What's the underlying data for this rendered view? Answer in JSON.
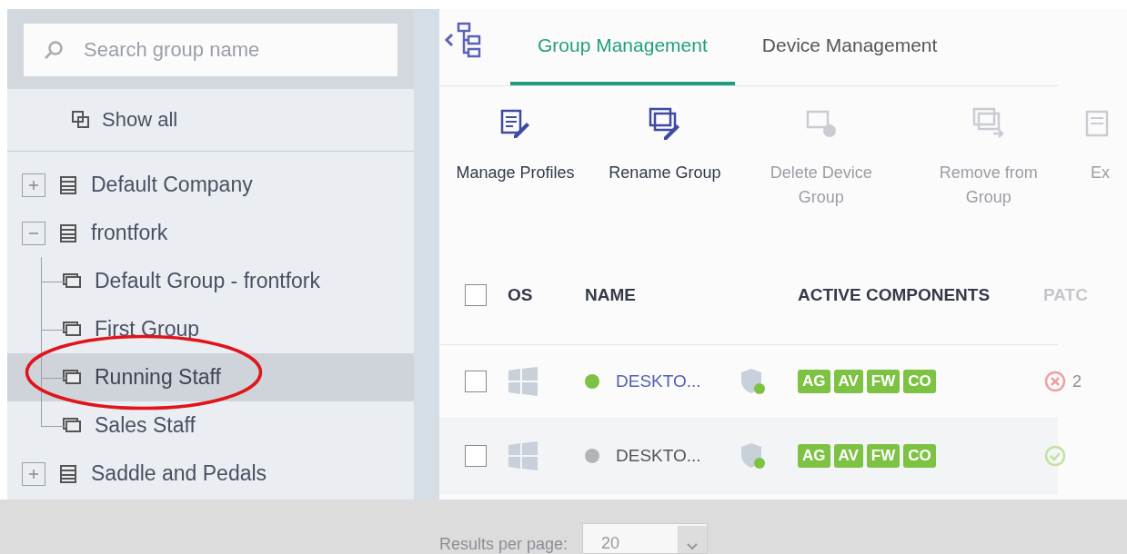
{
  "sidebar": {
    "search": {
      "placeholder": "Search group name"
    },
    "show_all": "Show all",
    "tree": [
      {
        "label": "Default Company",
        "expanded": false,
        "selected": false
      },
      {
        "label": "frontfork",
        "expanded": true,
        "selected": false,
        "children": [
          {
            "label": "Default Group - frontfork",
            "selected": false
          },
          {
            "label": "First Group",
            "selected": false
          },
          {
            "label": "Running Staff",
            "selected": true
          },
          {
            "label": "Sales Staff",
            "selected": false
          }
        ]
      },
      {
        "label": "Saddle and Pedals",
        "expanded": false,
        "selected": false
      }
    ]
  },
  "tabs": [
    {
      "label": "Group Management",
      "selected": true
    },
    {
      "label": "Device Management",
      "selected": false
    }
  ],
  "actions": [
    {
      "label": "Manage Profiles",
      "kind": "profiles",
      "disabled": false
    },
    {
      "label": "Rename Group",
      "kind": "rename",
      "disabled": false
    },
    {
      "label": "Delete Device Group",
      "kind": "delete",
      "disabled": true
    },
    {
      "label": "Remove from Group",
      "kind": "remove",
      "disabled": true
    },
    {
      "label": "Ex",
      "kind": "export",
      "disabled": true
    }
  ],
  "table": {
    "select_all": false,
    "columns": [
      {
        "label": "OS",
        "disabled": false
      },
      {
        "label": "NAME",
        "disabled": false
      },
      {
        "label": "ACTIVE COMPONENTS",
        "disabled": false
      },
      {
        "label": "PATC",
        "disabled": true
      }
    ],
    "rows": [
      {
        "checked": false,
        "name": "DESKTO...",
        "color": "#7dc243",
        "link": true,
        "components": [
          "AG",
          "AV",
          "FW",
          "CO"
        ],
        "patch": {
          "kind": "error",
          "count": "2"
        }
      },
      {
        "checked": false,
        "name": "DESKTO...",
        "color": "#b4b4b4",
        "link": false,
        "components": [
          "AG",
          "AV",
          "FW",
          "CO"
        ],
        "patch": {
          "kind": "ok"
        }
      }
    ]
  },
  "footer": {
    "label": "Results per page:",
    "value": "20"
  }
}
